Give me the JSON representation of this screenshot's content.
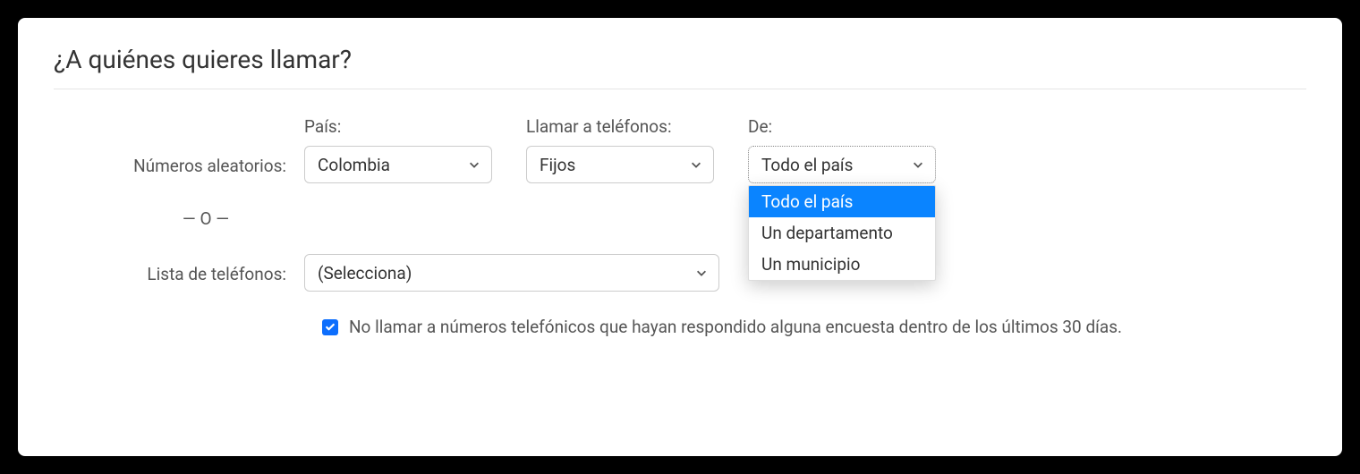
{
  "title": "¿A quiénes quieres llamar?",
  "labels": {
    "random_numbers": "Números aleatorios:",
    "country": "País:",
    "call_phones": "Llamar a teléfonos:",
    "from": "De:",
    "or": "— O —",
    "phone_list": "Lista de teléfonos:"
  },
  "selects": {
    "country": "Colombia",
    "phone_type": "Fijos",
    "scope": "Todo el país",
    "phone_list": "(Selecciona)"
  },
  "dropdown_options": {
    "opt1": "Todo el país",
    "opt2": "Un departamento",
    "opt3": "Un municipio"
  },
  "checkbox": {
    "label": "No llamar a números telefónicos que hayan respondido alguna encuesta dentro de los últimos 30 días."
  }
}
